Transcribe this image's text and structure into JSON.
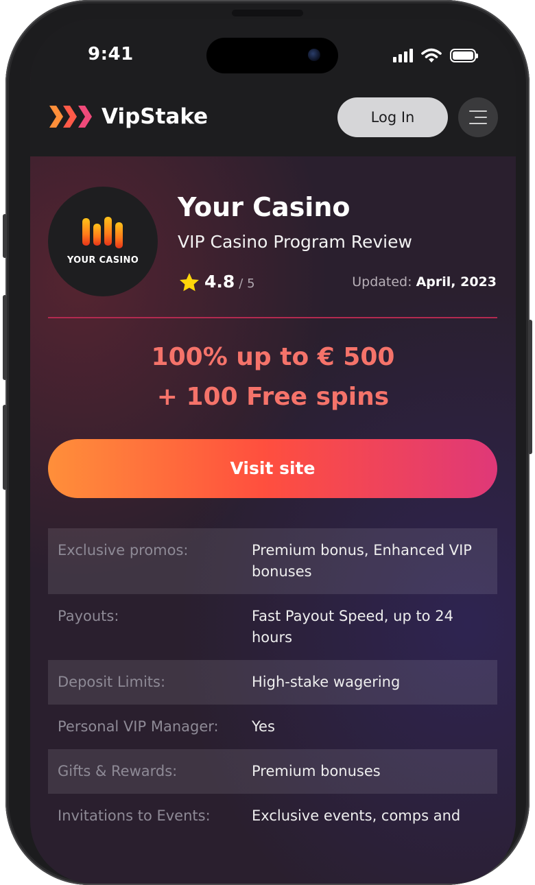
{
  "status_bar": {
    "time": "9:41",
    "icons": [
      "signal-icon",
      "wifi-icon",
      "battery-icon"
    ]
  },
  "header": {
    "brand_name": "VipStake",
    "login_label": "Log In",
    "menu_icon": "hamburger-icon"
  },
  "casino": {
    "logo_text": "YOUR CASINO",
    "name": "Your Casino",
    "subtitle": "VIP Casino Program Review",
    "rating": "4.8",
    "rating_max": "/ 5",
    "updated_label": "Updated:",
    "updated_value": "April, 2023"
  },
  "offer": {
    "line1": "100% up to € 500",
    "line2": "+ 100 Free spins"
  },
  "visit_label": "Visit site",
  "specs": [
    {
      "label": "Exclusive promos:",
      "value": "Premium bonus, Enhanced VIP bonuses"
    },
    {
      "label": "Payouts:",
      "value": "Fast Payout Speed, up to 24 hours"
    },
    {
      "label": "Deposit Limits:",
      "value": "High-stake wagering"
    },
    {
      "label": "Personal VIP Manager:",
      "value": "Yes"
    },
    {
      "label": "Gifts & Rewards:",
      "value": "Premium bonuses"
    },
    {
      "label": "Invitations to Events:",
      "value": "Exclusive events, comps and"
    }
  ],
  "colors": {
    "accent_orange": "#ff8f3a",
    "accent_red": "#ff4f3e",
    "accent_pink": "#df3878",
    "star": "#ffd60a",
    "divider": "#b32a50"
  }
}
